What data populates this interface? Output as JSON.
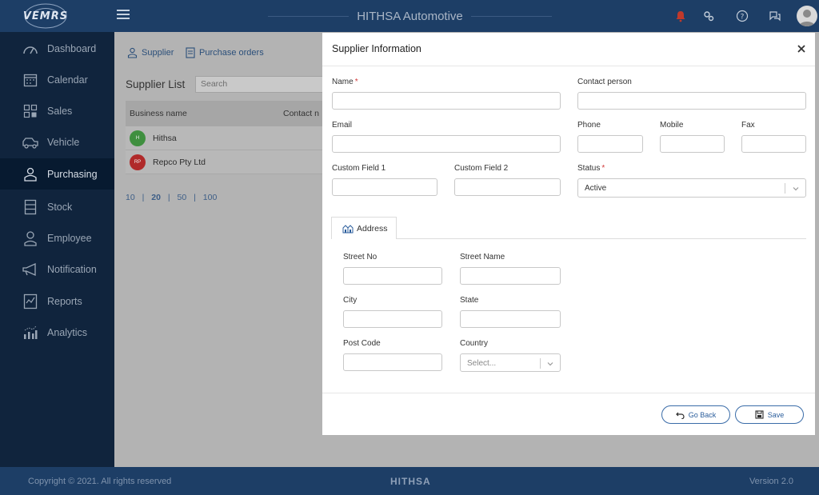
{
  "header": {
    "logo_text": "VEMRS",
    "app_title": "HITHSA Automotive",
    "icons": [
      "menu-icon",
      "notification-bell-icon",
      "settings-icon",
      "help-icon",
      "chat-icon",
      "user-avatar-icon"
    ]
  },
  "sidebar": {
    "items": [
      {
        "label": "Dashboard",
        "icon": "dashboard-icon"
      },
      {
        "label": "Calendar",
        "icon": "calendar-icon"
      },
      {
        "label": "Sales",
        "icon": "sales-icon"
      },
      {
        "label": "Vehicle",
        "icon": "vehicle-icon"
      },
      {
        "label": "Purchasing",
        "icon": "purchasing-icon",
        "active": true
      },
      {
        "label": "Stock",
        "icon": "stock-icon"
      },
      {
        "label": "Employee",
        "icon": "employee-icon"
      },
      {
        "label": "Notification",
        "icon": "megaphone-icon"
      },
      {
        "label": "Reports",
        "icon": "reports-icon"
      },
      {
        "label": "Analytics",
        "icon": "analytics-icon"
      }
    ]
  },
  "page": {
    "crumbs": [
      {
        "label": "Supplier",
        "icon": "supplier-icon"
      },
      {
        "label": "Purchase orders",
        "icon": "purchase-orders-icon"
      }
    ],
    "list_title": "Supplier List",
    "search_placeholder": "Search",
    "table": {
      "columns": [
        "Business name",
        "Contact n"
      ],
      "rows": [
        {
          "initials": "H",
          "name": "Hithsa",
          "color": "#3f8f3f"
        },
        {
          "initials": "RP",
          "name": "Repco Pty Ltd",
          "color": "#b02a2a"
        }
      ]
    },
    "pager": [
      "10",
      "20",
      "50",
      "100"
    ],
    "pager_selected": "20"
  },
  "modal": {
    "title": "Supplier Information",
    "fields": {
      "name": "Name",
      "contact_person": "Contact person",
      "email": "Email",
      "phone": "Phone",
      "mobile": "Mobile",
      "fax": "Fax",
      "custom1": "Custom Field 1",
      "custom2": "Custom Field 2",
      "status": "Status",
      "status_value": "Active"
    },
    "address_tab": "Address",
    "address": {
      "street_no": "Street No",
      "street_name": "Street Name",
      "city": "City",
      "state": "State",
      "post_code": "Post Code",
      "country": "Country",
      "country_placeholder": "Select..."
    },
    "buttons": {
      "go_back": "Go Back",
      "save": "Save"
    }
  },
  "footer": {
    "copyright": "Copyright © 2021. All rights reserved",
    "brand": "HITHSA",
    "version": "Version 2.0"
  },
  "colors": {
    "topbar": "#1d3e66",
    "sidebar": "#10243d",
    "accent": "#2b5e9c",
    "required": "#d23b3b"
  }
}
